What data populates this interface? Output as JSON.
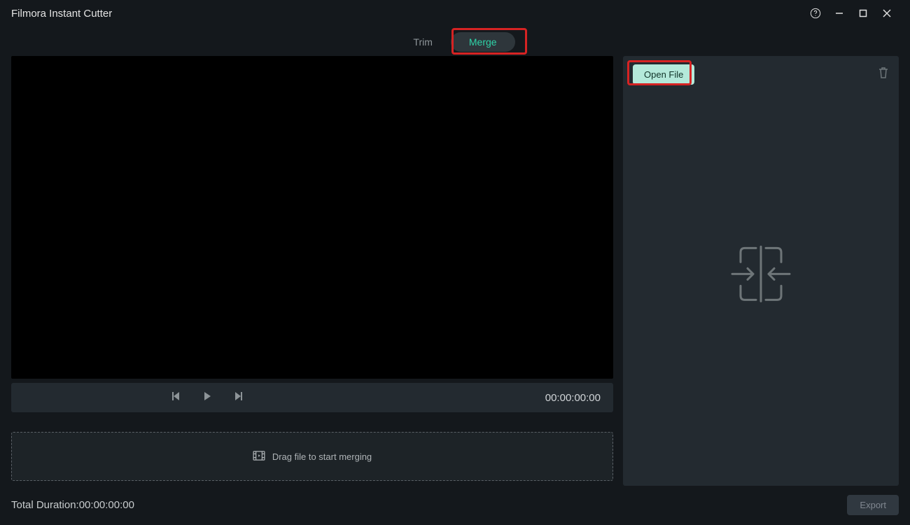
{
  "app": {
    "title": "Filmora Instant Cutter"
  },
  "tabs": {
    "trim": "Trim",
    "merge": "Merge"
  },
  "transport": {
    "timecode": "00:00:00:00"
  },
  "dropzone": {
    "hint": "Drag file to start merging"
  },
  "sidepanel": {
    "open_file": "Open File"
  },
  "footer": {
    "duration_label": "Total Duration: ",
    "duration_value": "00:00:00:00",
    "export": "Export"
  }
}
